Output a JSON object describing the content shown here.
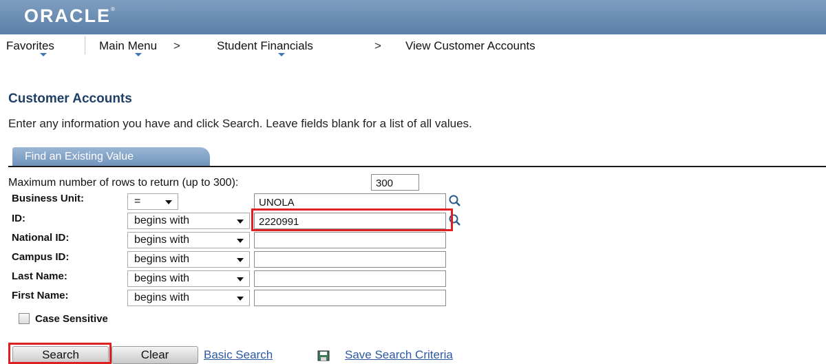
{
  "header": {
    "logo": "ORACLE"
  },
  "nav": {
    "favorites": "Favorites",
    "main_menu": "Main Menu",
    "separator": ">",
    "student_financials": "Student Financials",
    "current": "View Customer Accounts"
  },
  "page": {
    "title": "Customer Accounts",
    "instructions": "Enter any information you have and click Search. Leave fields blank for a list of all values."
  },
  "tab": {
    "label": "Find an Existing Value"
  },
  "form": {
    "max_rows_label": "Maximum number of rows to return (up to 300):",
    "max_rows_value": "300",
    "fields": [
      {
        "label": "Business Unit:",
        "operator": "=",
        "value": "UNOLA"
      },
      {
        "label": "ID:",
        "operator": "begins with",
        "value": "2220991"
      },
      {
        "label": "National ID:",
        "operator": "begins with",
        "value": ""
      },
      {
        "label": "Campus ID:",
        "operator": "begins with",
        "value": ""
      },
      {
        "label": "Last Name:",
        "operator": "begins with",
        "value": ""
      },
      {
        "label": "First Name:",
        "operator": "begins with",
        "value": ""
      }
    ],
    "case_sensitive_label": "Case Sensitive"
  },
  "actions": {
    "search": "Search",
    "clear": "Clear",
    "basic_search": "Basic Search",
    "save_criteria": "Save Search Criteria"
  },
  "colors": {
    "header": "#5a7fa8",
    "title": "#1f3f66",
    "link": "#2d59a0",
    "highlight": "#e02020"
  },
  "icons": [
    "lookup-icon",
    "save-icon"
  ]
}
